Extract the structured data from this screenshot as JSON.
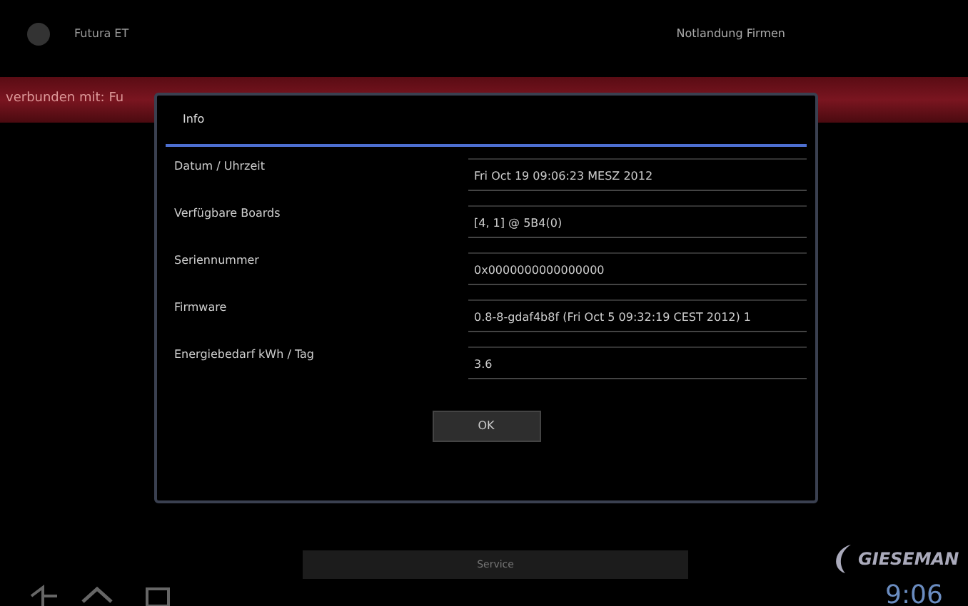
{
  "action_bar": {
    "app_title": "Futura ET",
    "menu_item": "Notlandung Firmen"
  },
  "banner": {
    "text": "verbunden mit: Fu"
  },
  "dialog": {
    "title": "Info",
    "rows": [
      {
        "label": "Datum / Uhrzeit",
        "value": "Fri Oct 19 09:06:23 MESZ 2012"
      },
      {
        "label": "Verfügbare Boards",
        "value": "[4, 1] @ 5B4(0)"
      },
      {
        "label": "Seriennummer",
        "value": "0x0000000000000000"
      },
      {
        "label": "Firmware",
        "value": "0.8-8-gdaf4b8f (Fri Oct  5 09:32:19 CEST 2012) 1"
      },
      {
        "label": "Energiebedarf kWh / Tag",
        "value": "3.6"
      }
    ],
    "ok_button": "OK"
  },
  "service_button": "Service",
  "logo": {
    "text": "GIESEMAN"
  },
  "status_bar": {
    "clock": "9:06"
  }
}
